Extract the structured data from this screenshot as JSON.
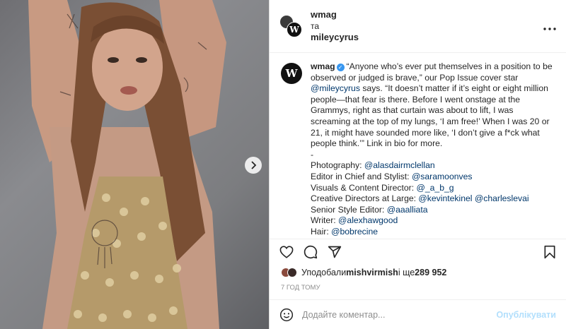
{
  "header": {
    "user1": "wmag",
    "conjunction": "та",
    "user2": "mileycyrus",
    "more_icon": "more-horizontal-icon"
  },
  "post_image": {
    "next_icon": "chevron-right-icon"
  },
  "caption": {
    "author": "wmag",
    "part1": "“Anyone who’s ever put themselves in a position to be observed or judged is brave,” our Pop Issue cover star ",
    "mention_subject": "@mileycyrus",
    "part2": " says. “It doesn’t matter if it’s eight or eight million people—that fear is there. Before I went onstage at the Grammys, right as that curtain was about to lift, I was screaming at the top of my lungs, ‘I am free!’ When I was 20 or 21, it might have sounded more like, ‘I don’t give a f*ck what people think.’” Link in bio for more.",
    "dash": "-",
    "credits": [
      {
        "label": "Photography: ",
        "mentions": [
          "@alasdairmclellan"
        ]
      },
      {
        "label": "Editor in Chief and Stylist: ",
        "mentions": [
          "@saramoonves"
        ]
      },
      {
        "label": "Visuals & Content Director: ",
        "mentions": [
          "@_a_b_g"
        ]
      },
      {
        "label": "Creative Directors at Large: ",
        "mentions": [
          "@kevintekinel",
          "@charleslevai"
        ]
      },
      {
        "label": "Senior Style Editor: ",
        "mentions": [
          "@aaalliata"
        ]
      },
      {
        "label": "Writer: ",
        "mentions": [
          "@alexhawgood"
        ]
      },
      {
        "label": "Hair: ",
        "mentions": [
          "@bobrecine"
        ]
      }
    ]
  },
  "actions": {
    "like_icon": "heart-icon",
    "comment_icon": "comment-icon",
    "share_icon": "share-icon",
    "save_icon": "bookmark-icon"
  },
  "likes": {
    "prefix": "Уподобали ",
    "user": "mishvirmish",
    "middle": " і ще ",
    "count": "289 952"
  },
  "timestamp": "7 ГОД ТОМУ",
  "comment_box": {
    "emoji_icon": "emoji-icon",
    "placeholder": "Додайте коментар...",
    "submit": "Опублікувати"
  },
  "colors": {
    "link": "#00376b",
    "verified": "#3897f0",
    "publish_disabled": "#b2dffc",
    "muted": "#8e8e8e"
  }
}
